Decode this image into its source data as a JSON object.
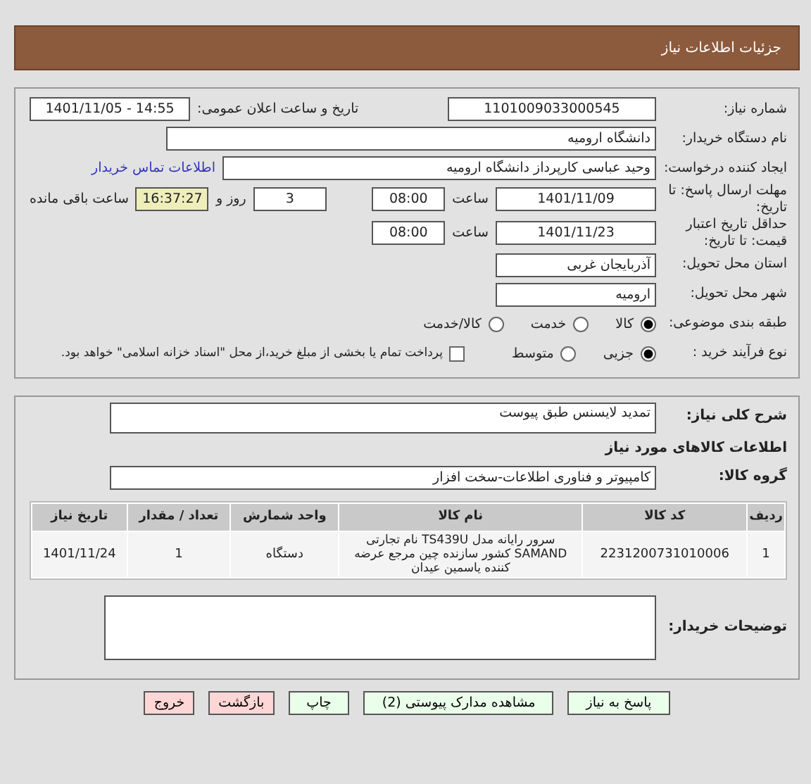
{
  "title": "جزئیات اطلاعات نیاز",
  "need_number": {
    "label": "شماره نیاز:",
    "value": "1101009033000545"
  },
  "announce": {
    "label": "تاریخ و ساعت اعلان عمومی:",
    "value": "1401/11/05 - 14:55"
  },
  "buyer": {
    "label": "نام دستگاه خریدار:",
    "value": "دانشگاه ارومیه"
  },
  "requester": {
    "label": "ایجاد کننده درخواست:",
    "value": "وحید عباسی کارپرداز دانشگاه ارومیه",
    "link": "اطلاعات تماس خریدار"
  },
  "deadline": {
    "label": "مهلت ارسال پاسخ: تا تاریخ:",
    "date": "1401/11/09",
    "time_label": "ساعت",
    "time": "08:00",
    "days": "3",
    "days_label": "روز و",
    "remaining": "16:37:27",
    "remaining_label": "ساعت باقی مانده"
  },
  "validity": {
    "label": "حداقل تاریخ اعتبار قیمت: تا تاریخ:",
    "date": "1401/11/23",
    "time_label": "ساعت",
    "time": "08:00"
  },
  "province": {
    "label": "استان محل تحویل:",
    "value": "آذربایجان غربی"
  },
  "city": {
    "label": "شهر محل تحویل:",
    "value": "ارومیه"
  },
  "category": {
    "label": "طبقه بندی موضوعی:",
    "options": [
      {
        "label": "کالا",
        "selected": true
      },
      {
        "label": "خدمت",
        "selected": false
      },
      {
        "label": "کالا/خدمت",
        "selected": false
      }
    ]
  },
  "process": {
    "label": "نوع فرآیند خرید :",
    "options": [
      {
        "label": "جزیی",
        "selected": true
      },
      {
        "label": "متوسط",
        "selected": false
      }
    ],
    "checkbox": {
      "label": "پرداخت تمام یا بخشی از مبلغ خرید،از محل \"اسناد خزانه اسلامی\" خواهد بود.",
      "checked": false
    }
  },
  "description": {
    "label": "شرح کلی نیاز:",
    "value": "تمدید لایسنس طبق پیوست"
  },
  "goods_title": "اطلاعات کالاهای مورد نیاز",
  "group": {
    "label": "گروه کالا:",
    "value": "کامپیوتر و فناوری اطلاعات-سخت افزار"
  },
  "table": {
    "columns": [
      "ردیف",
      "کد کالا",
      "نام کالا",
      "واحد شمارش",
      "تعداد / مقدار",
      "تاریخ نیاز"
    ],
    "rows": [
      [
        "1",
        "2231200731010006",
        "سرور رایانه مدل TS439U نام تجارتی SAMAND کشور سازنده چین مرجع عرضه کننده یاسمین عیدان",
        "دستگاه",
        "1",
        "1401/11/24"
      ]
    ]
  },
  "buyer_notes": {
    "label": "توضیحات خریدار:"
  },
  "buttons": [
    {
      "label": "پاسخ به نیاز",
      "kind": "normal"
    },
    {
      "label": "مشاهده مدارک پیوستی (2)",
      "kind": "normal"
    },
    {
      "label": "چاپ",
      "kind": "normal"
    },
    {
      "label": "بازگشت",
      "kind": "danger"
    },
    {
      "label": "خروج",
      "kind": "danger"
    }
  ]
}
